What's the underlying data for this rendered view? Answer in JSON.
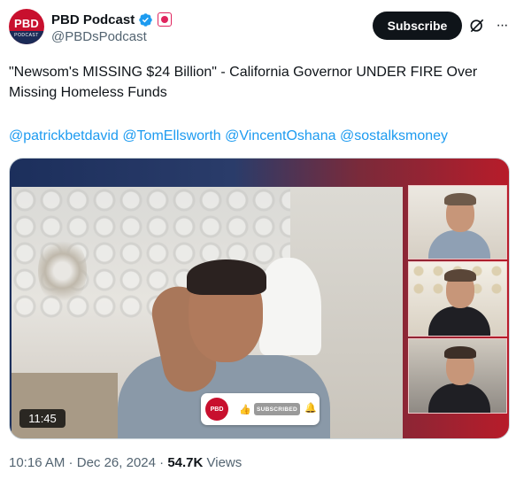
{
  "author": {
    "display_name": "PBD Podcast",
    "handle": "@PBDsPodcast",
    "avatar_text": "PBD",
    "avatar_subtext": "PODCAST",
    "verified_icon": "verified-badge-icon",
    "affiliation_icon": "affiliation-badge-icon"
  },
  "header": {
    "subscribe_label": "Subscribe",
    "grok_icon": "grok-icon",
    "more_icon": "more-options-icon",
    "more_glyph": "···"
  },
  "tweet": {
    "text": "\"Newsom's MISSING $24 Billion\" - California Governor UNDER FIRE Over Missing Homeless Funds",
    "mentions": [
      "@patrickbetdavid",
      "@TomEllsworth",
      "@VincentOshana",
      "@sostalksmoney"
    ]
  },
  "media": {
    "duration": "11:45",
    "overlay_logo_text": "PBD",
    "overlay_like_icon": "thumbs-up-icon",
    "overlay_like_glyph": "👍",
    "overlay_subscribed_label": "SUBSCRIBED",
    "overlay_bell_icon": "bell-icon",
    "overlay_bell_glyph": "🔔"
  },
  "meta": {
    "time": "10:16 AM",
    "separator": " · ",
    "date": "Dec 26, 2024",
    "views_count": "54.7K",
    "views_label": " Views"
  },
  "colors": {
    "link": "#1d9bf0",
    "verified": "#1d9bf0",
    "brand_red": "#c8102e",
    "brand_navy": "#1b2b57",
    "text_secondary": "#536471"
  }
}
